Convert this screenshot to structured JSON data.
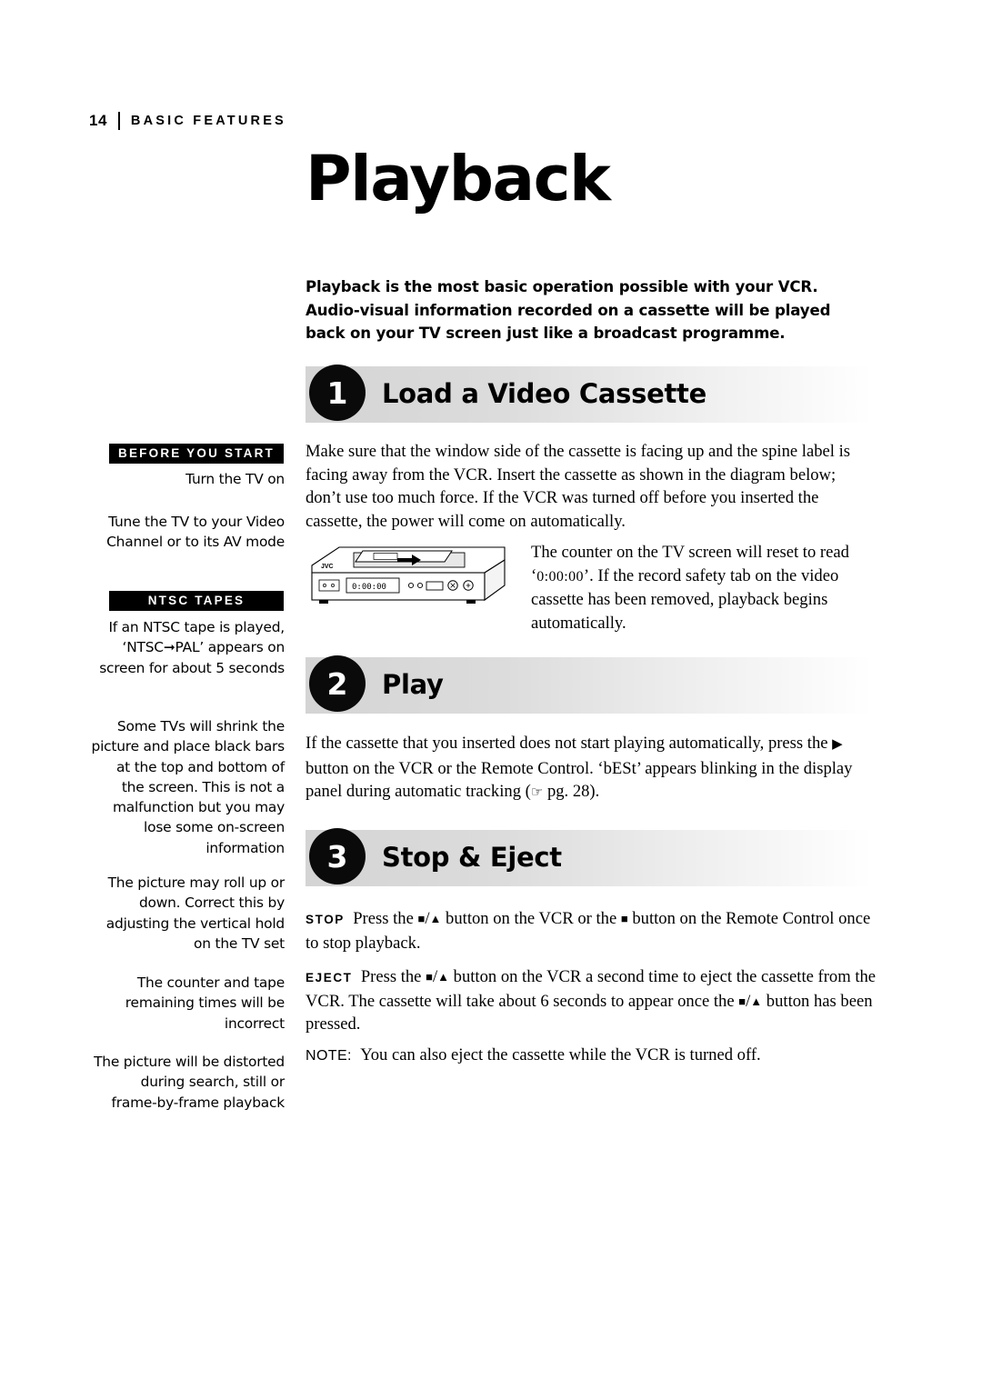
{
  "header": {
    "page_number": "14",
    "section": "BASIC FEATURES"
  },
  "title": "Playback",
  "intro": "Playback is the most basic operation possible with your VCR. Audio-visual information recorded on a cassette will be played back on your TV screen just like a broadcast programme.",
  "steps": [
    {
      "number": "1",
      "label": "Load a Video Cassette"
    },
    {
      "number": "2",
      "label": "Play"
    },
    {
      "number": "3",
      "label": "Stop & Eject"
    }
  ],
  "body": {
    "step1_para": "Make sure that the window side of the cassette is facing up and the spine label is facing away from the VCR. Insert the cassette as shown in the diagram below; don’t use too much force. If the VCR was turned off before you inserted the cassette, the power will come on automatically.",
    "counter_para_a": "The counter on the TV screen will reset to read ‘",
    "counter_value": "0:00:00",
    "counter_para_b": "’. If the record safety tab on the video cassette has been removed, playback begins automatically.",
    "step2_para_a": "If the cassette that you inserted does not start playing automatically, press the ",
    "step2_para_b": " button on the VCR or the Remote Control. ‘bESt’ appears blinking in the display panel during automatic tracking (",
    "step2_page_ref": " pg. 28).",
    "stop_label": "STOP",
    "stop_text_a": "Press the ",
    "stop_text_b": " button on the VCR or the ",
    "stop_text_c": " button on the Remote Control once to stop playback.",
    "eject_label": "EJECT",
    "eject_text_a": "Press the ",
    "eject_text_b": " button on the VCR a second time to eject the cassette from the VCR. The cassette will take about 6 seconds to appear once the ",
    "eject_text_c": " button has been pressed.",
    "note_label": "NOTE:",
    "note_text": "You can also eject the cassette while the VCR is turned off."
  },
  "sidebar": {
    "before_tag": "BEFORE YOU START",
    "ntsc_tag": "NTSC TAPES",
    "notes": [
      "Turn the TV on",
      "Tune the TV to your Video Channel or to its AV mode",
      "If an NTSC tape is played, ‘NTSC➞PAL’ appears on screen for about 5 seconds",
      "Some TVs will shrink the picture and place black bars at the top and bottom of the screen. This is not a malfunction but you may lose some on-screen information",
      "The picture may roll up or down. Correct this by adjusting the vertical hold on the TV set",
      "The counter and tape remaining times will be incorrect",
      "The picture will be distorted during search, still or frame-by-frame playback"
    ]
  },
  "illustration": {
    "brand": "JVC",
    "display_text": "0:00:00"
  },
  "glyphs": {
    "stop_square": "■",
    "eject_tri": "▲",
    "play_tri": "▶",
    "hand": "☞"
  }
}
